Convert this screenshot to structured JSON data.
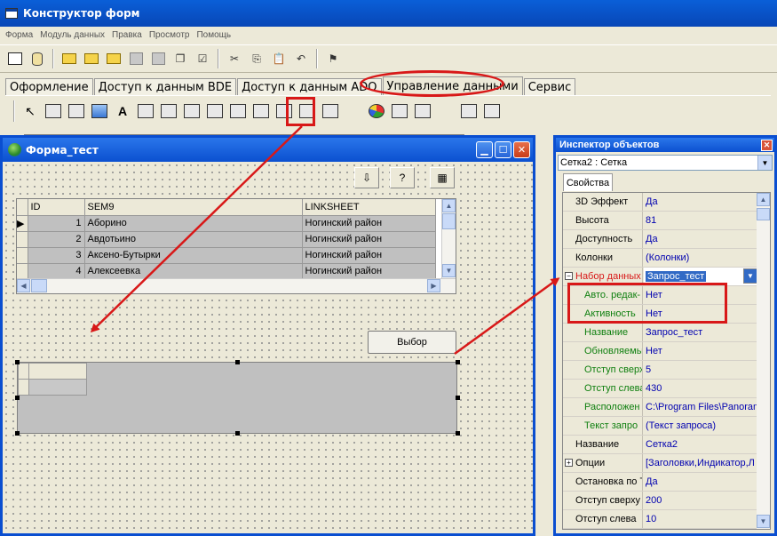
{
  "app": {
    "title": "Конструктор форм"
  },
  "menu": [
    "Форма",
    "Модуль данных",
    "Правка",
    "Просмотр",
    "Помощь"
  ],
  "toolbar": {
    "icons": [
      "new-form-icon",
      "database-icon",
      "open-folder-icon",
      "open-folder-icon",
      "open-folder-icon",
      "save-icon",
      "save-all-icon",
      "copy-window-icon",
      "checklist-icon",
      "cut-icon",
      "copy-icon",
      "paste-icon",
      "undo-icon",
      "run-icon"
    ]
  },
  "tabs": [
    {
      "label": "Оформление"
    },
    {
      "label": "Доступ к данным BDE"
    },
    {
      "label": "Доступ к данным ADO"
    },
    {
      "label": "Управление данными"
    },
    {
      "label": "Сервис"
    }
  ],
  "form_window": {
    "title": "Форма_тест",
    "select_button": "Выбор",
    "grid": {
      "columns": [
        "ID",
        "SEM9",
        "LINKSHEET"
      ],
      "rows": [
        {
          "id": "1",
          "sem9": "Аборино",
          "link": "Ногинский район"
        },
        {
          "id": "2",
          "sem9": "Авдотьино",
          "link": "Ногинский район"
        },
        {
          "id": "3",
          "sem9": "Аксено-Бутырки",
          "link": "Ногинский район"
        },
        {
          "id": "4",
          "sem9": "Алексеевка",
          "link": "Ногинский район"
        }
      ]
    }
  },
  "inspector": {
    "title": "Инспектор объектов",
    "object": "Сетка2 : Сетка",
    "tab": "Свойства",
    "properties": [
      {
        "name": "3D Эффект",
        "value": "Да",
        "kind": "normal"
      },
      {
        "name": "Высота",
        "value": "81",
        "kind": "normal"
      },
      {
        "name": "Доступность",
        "value": "Да",
        "kind": "normal"
      },
      {
        "name": "Колонки",
        "value": "(Колонки)",
        "kind": "normal"
      },
      {
        "name": "Набор данных",
        "value": "Запрос_тест",
        "kind": "expanded"
      },
      {
        "name": "Авто. редак-",
        "value": "Нет",
        "kind": "sub"
      },
      {
        "name": "Активность",
        "value": "Нет",
        "kind": "sub"
      },
      {
        "name": "Название",
        "value": "Запрос_тест",
        "kind": "sub"
      },
      {
        "name": "Обновляемы",
        "value": "Нет",
        "kind": "sub"
      },
      {
        "name": "Отступ сверх",
        "value": "5",
        "kind": "sub"
      },
      {
        "name": "Отступ слева",
        "value": "430",
        "kind": "sub"
      },
      {
        "name": "Расположен",
        "value": "C:\\Program Files\\Panoram",
        "kind": "sub"
      },
      {
        "name": "Текст запро",
        "value": "(Текст запроса)",
        "kind": "sub"
      },
      {
        "name": "Название",
        "value": "Сетка2",
        "kind": "normal"
      },
      {
        "name": "Опции",
        "value": "[Заголовки,Индикатор,Л",
        "kind": "collapsed"
      },
      {
        "name": "Остановка по Т",
        "value": "Да",
        "kind": "normal"
      },
      {
        "name": "Отступ сверху",
        "value": "200",
        "kind": "normal"
      },
      {
        "name": "Отступ слева",
        "value": "10",
        "kind": "normal"
      }
    ]
  },
  "colors": {
    "titlebar": "#0a4ed0",
    "highlight": "#d81818",
    "subprop": "#0e7f0e",
    "value": "#0000b0"
  }
}
